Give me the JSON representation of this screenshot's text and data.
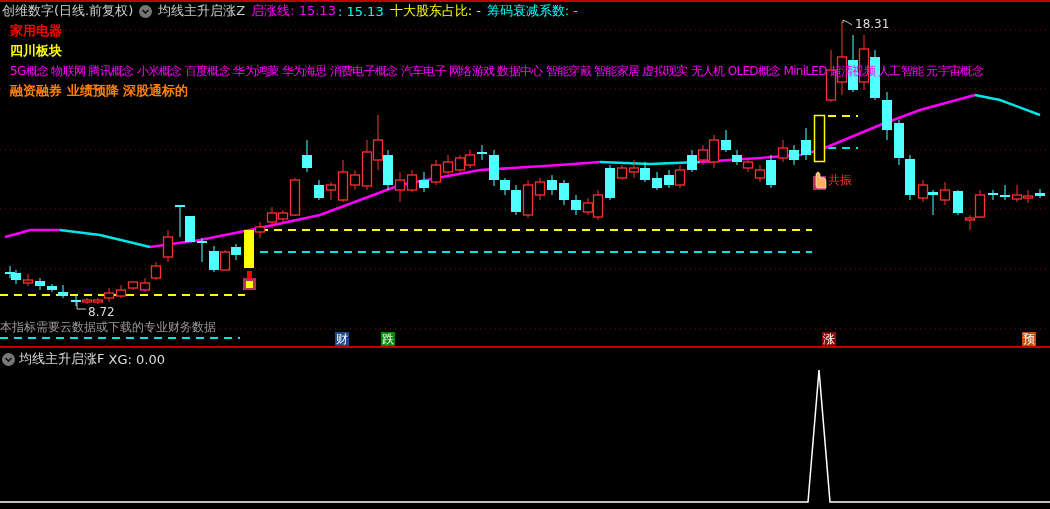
{
  "header": {
    "security": "创维数字(日线.前复权)",
    "indicator": "均线主升启涨Z",
    "fields": [
      {
        "text": "启涨线: 15.13",
        "color": "#ff00ff"
      },
      {
        "text": ": 15.13",
        "color": "#00ffff"
      },
      {
        "text": "十大股东占比: -",
        "color": "#ffff00"
      },
      {
        "text": "筹码衰减系数: -",
        "color": "#00ffff"
      }
    ]
  },
  "tags": [
    {
      "text": "家用电器",
      "color": "#ff0000"
    },
    {
      "text": "四川板块",
      "color": "#ffff00"
    },
    {
      "text": "5G概念 物联网 腾讯概念 小米概念 百度概念 华为鸿蒙 华为海思 消费电子概念 汽车电子 网络游戏 数据中心 智能穿戴 智能家居 虚拟现实 无人机 OLED概念 MiniLED 超清视频 人工智能 元宇宙概念",
      "color": "#ff00ff"
    },
    {
      "text": "融资融券 业绩预降 深股通标的",
      "color": "#ff8000"
    }
  ],
  "chart": {
    "high_label": "18.31",
    "low_label": "8.72",
    "signal_label": "共振",
    "notice": "本指标需要云数据或下载的专业财务数据"
  },
  "badges": [
    {
      "text": "财",
      "color": "#1a4a8a"
    },
    {
      "text": "跌",
      "color": "#0a8a0a"
    },
    {
      "text": "涨",
      "color": "#8a0a0a"
    },
    {
      "text": "预",
      "color": "#c05010"
    }
  ],
  "lower_panel": {
    "title": "均线主升启涨F",
    "reading": "XG: 0.00"
  }
}
